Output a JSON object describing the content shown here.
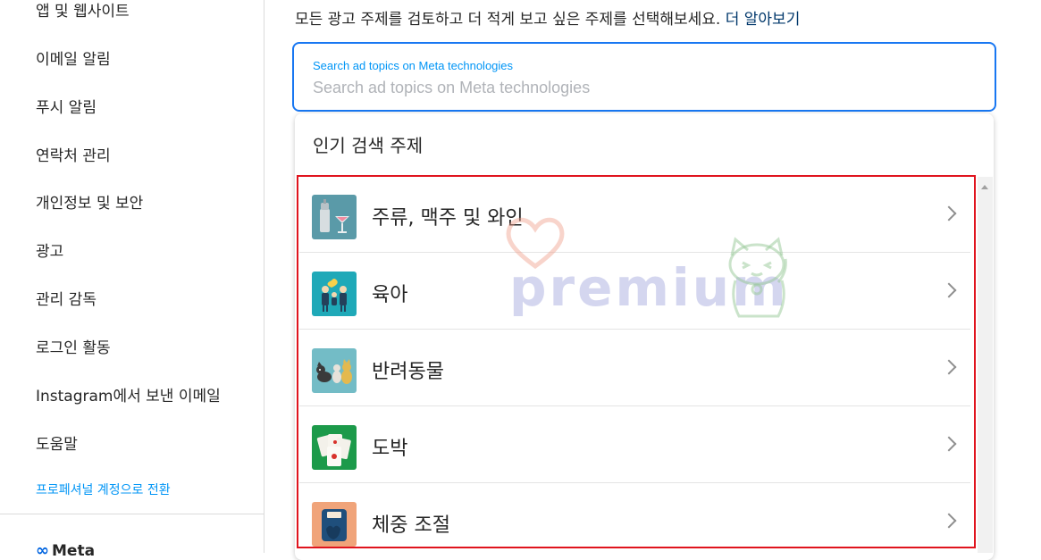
{
  "sidebar": {
    "items": [
      {
        "label": "앱 및 웹사이트"
      },
      {
        "label": "이메일 알림"
      },
      {
        "label": "푸시 알림"
      },
      {
        "label": "연락처 관리"
      },
      {
        "label": "개인정보 및 보안"
      },
      {
        "label": "광고"
      },
      {
        "label": "관리 감독"
      },
      {
        "label": "로그인 활동"
      },
      {
        "label": "Instagram에서 보낸 이메일"
      },
      {
        "label": "도움말"
      }
    ],
    "switch_professional": "프로페셔널 계정으로 전환",
    "meta_logo": "Meta"
  },
  "main": {
    "intro_text": "모든 광고 주제를 검토하고 더 적게 보고 싶은 주제를 선택해보세요.",
    "learn_more": "더 알아보기",
    "search": {
      "label": "Search ad topics on Meta technologies",
      "placeholder": "Search ad topics on Meta technologies",
      "value": ""
    },
    "dropdown": {
      "title": "인기 검색 주제",
      "topics": [
        {
          "label": "주류, 맥주 및 와인",
          "icon": "cocktail-shaker-icon"
        },
        {
          "label": "육아",
          "icon": "family-icon"
        },
        {
          "label": "반려동물",
          "icon": "pets-icon"
        },
        {
          "label": "도박",
          "icon": "playing-cards-icon"
        },
        {
          "label": "체중 조절",
          "icon": "scale-icon"
        }
      ]
    }
  },
  "watermark": {
    "text": "premium"
  },
  "colors": {
    "accent_blue": "#1877f2",
    "link_blue": "#0095f6",
    "highlight_red": "#e0141e"
  }
}
